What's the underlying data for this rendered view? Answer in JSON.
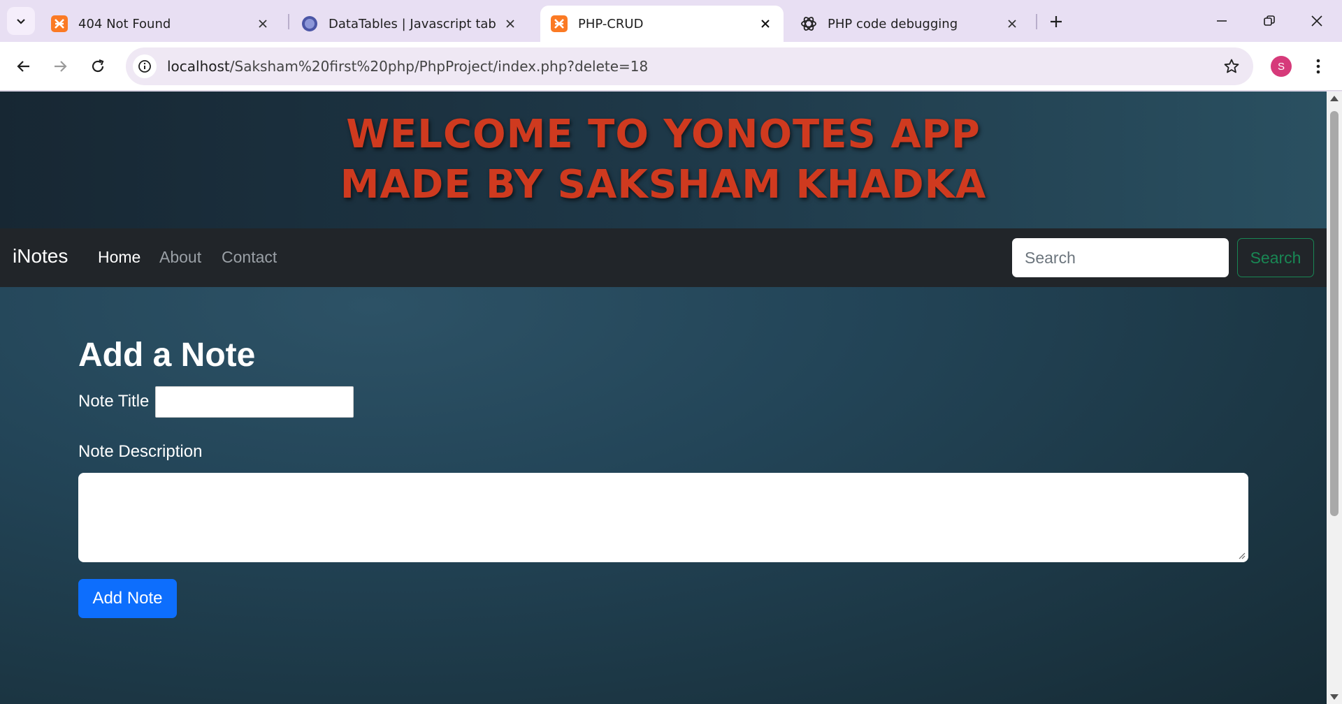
{
  "browser": {
    "tabs": [
      {
        "title": "404 Not Found",
        "icon": "xampp-icon",
        "active": false
      },
      {
        "title": "DataTables | Javascript table libr",
        "icon": "datatables-icon",
        "active": false
      },
      {
        "title": "PHP-CRUD",
        "icon": "xampp-icon",
        "active": true
      },
      {
        "title": "PHP code debugging",
        "icon": "chatgpt-icon",
        "active": false
      }
    ],
    "url_host": "localhost",
    "url_path": "/Saksham%20first%20php/PhpProject/index.php?delete=18",
    "profile_initial": "S",
    "profile_color": "#d63a7a"
  },
  "hero": {
    "line1": "WELCOME TO YONOTES APP",
    "line2": "MADE BY SAKSHAM KHADKA",
    "color": "#cf3a1f"
  },
  "navbar": {
    "brand": "iNotes",
    "links": [
      "Home",
      "About",
      "Contact"
    ],
    "search_placeholder": "Search",
    "search_button": "Search"
  },
  "form": {
    "heading": "Add a Note",
    "title_label": "Note Title",
    "title_value": "",
    "description_label": "Note Description",
    "description_value": "",
    "submit_label": "Add Note",
    "submit_color": "#0d6efd"
  }
}
